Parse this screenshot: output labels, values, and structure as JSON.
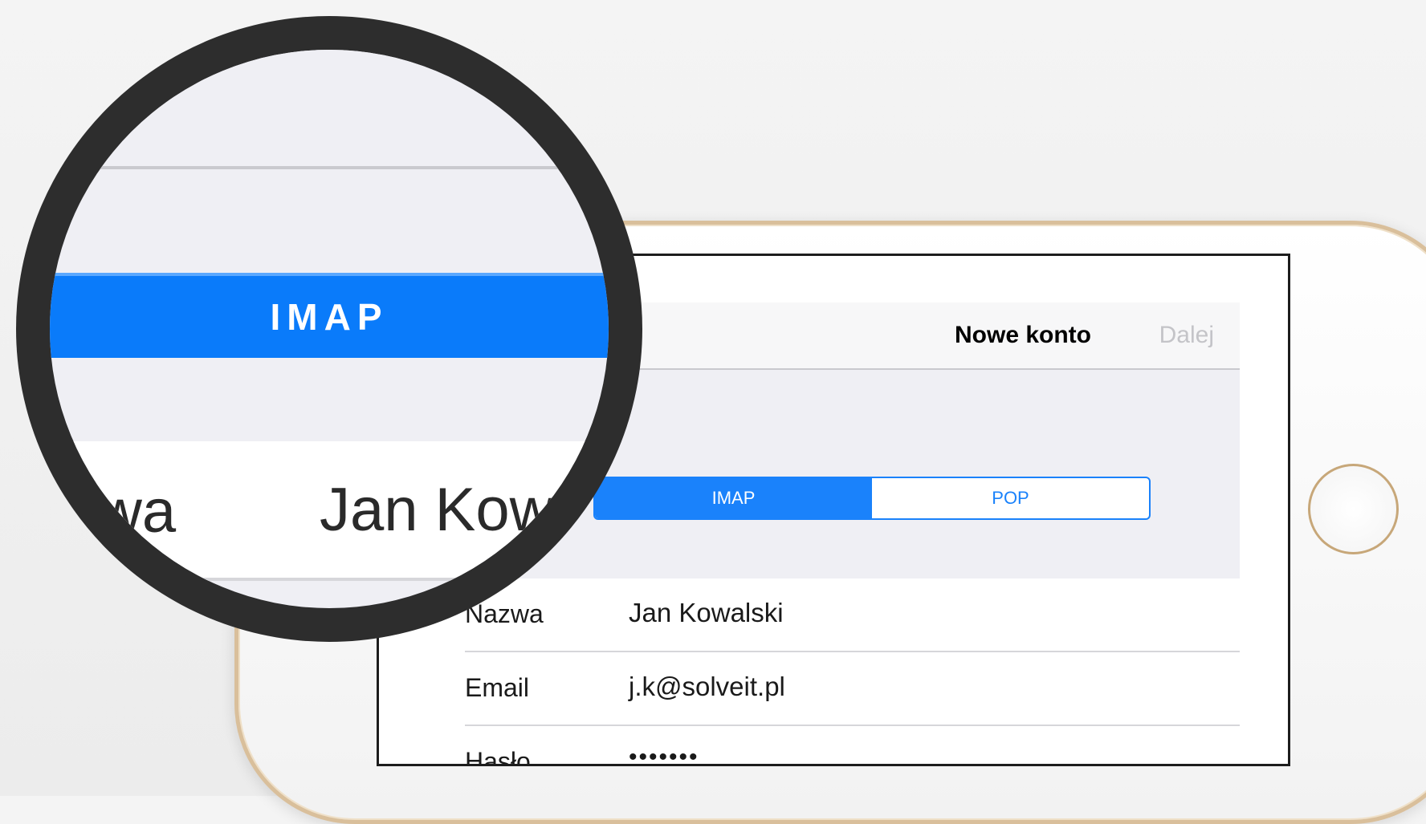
{
  "navbar": {
    "title": "Nowe konto",
    "next_label": "Dalej"
  },
  "segmented": {
    "options": [
      "IMAP",
      "POP"
    ],
    "selected": "IMAP"
  },
  "form": {
    "rows": [
      {
        "label": "Nazwa",
        "value": "Jan Kowalski"
      },
      {
        "label": "Email",
        "value": "j.k@solveit.pl"
      },
      {
        "label": "Hasło",
        "value": "•••••••"
      }
    ]
  },
  "magnifier": {
    "bar_text": "IMAP",
    "label_fragment": "wa",
    "value_fragment": "Jan Kowa"
  },
  "colors": {
    "accent": "#1a82fb",
    "phone_trim": "#d9bf9b"
  }
}
